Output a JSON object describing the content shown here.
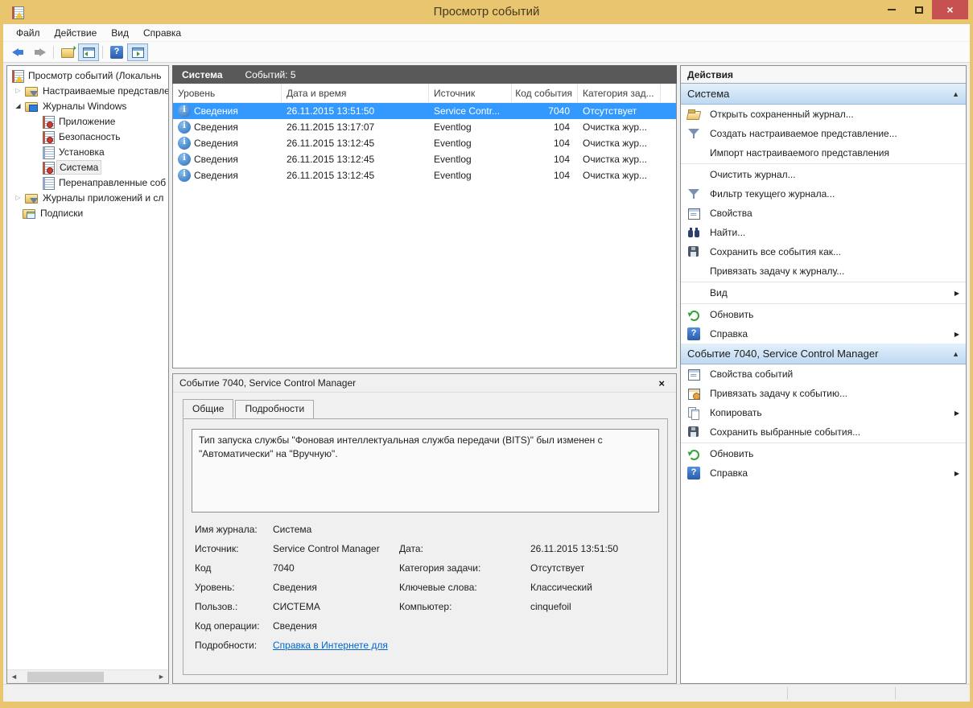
{
  "window": {
    "title": "Просмотр событий",
    "controls": {
      "minimize": "minimize",
      "maximize": "maximize",
      "close": "×"
    }
  },
  "menu": {
    "items": [
      {
        "label": "Файл"
      },
      {
        "label": "Действие"
      },
      {
        "label": "Вид"
      },
      {
        "label": "Справка"
      }
    ]
  },
  "toolbar": {
    "icons": [
      "back",
      "forward",
      "export-log",
      "toggle-console-tree",
      "help",
      "toggle-action-pane"
    ]
  },
  "tree": {
    "items": [
      {
        "label": "Просмотр событий (Локальнь",
        "icon": "event-viewer-root",
        "level": 0
      },
      {
        "label": "Настраиваемые представле",
        "icon": "folder-filter",
        "level": 1,
        "state": "collapsed"
      },
      {
        "label": "Журналы Windows",
        "icon": "folder-screen",
        "level": 1,
        "state": "expanded"
      },
      {
        "label": "Приложение",
        "icon": "log-alert",
        "level": 2
      },
      {
        "label": "Безопасность",
        "icon": "log-alert",
        "level": 2
      },
      {
        "label": "Установка",
        "icon": "log-plain",
        "level": 2
      },
      {
        "label": "Система",
        "icon": "log-alert",
        "level": 2,
        "selected": true
      },
      {
        "label": "Перенаправленные соб",
        "icon": "log-plain",
        "level": 2
      },
      {
        "label": "Журналы приложений и сл",
        "icon": "folder-filter",
        "level": 1,
        "state": "collapsed"
      },
      {
        "label": "Подписки",
        "icon": "subscriptions",
        "level": 1
      }
    ]
  },
  "list": {
    "caption": "Система",
    "count": "Событий: 5",
    "columns": [
      "Уровень",
      "Дата и время",
      "Источник",
      "Код события",
      "Категория зад..."
    ],
    "rows": [
      {
        "icon": "info",
        "level": "Сведения",
        "datetime": "26.11.2015 13:51:50",
        "source": "Service Contr...",
        "code": "7040",
        "category": "Отсутствует",
        "selected": true
      },
      {
        "icon": "info",
        "level": "Сведения",
        "datetime": "26.11.2015 13:17:07",
        "source": "Eventlog",
        "code": "104",
        "category": "Очистка жур..."
      },
      {
        "icon": "info",
        "level": "Сведения",
        "datetime": "26.11.2015 13:12:45",
        "source": "Eventlog",
        "code": "104",
        "category": "Очистка жур..."
      },
      {
        "icon": "info",
        "level": "Сведения",
        "datetime": "26.11.2015 13:12:45",
        "source": "Eventlog",
        "code": "104",
        "category": "Очистка жур..."
      },
      {
        "icon": "info",
        "level": "Сведения",
        "datetime": "26.11.2015 13:12:45",
        "source": "Eventlog",
        "code": "104",
        "category": "Очистка жур..."
      }
    ]
  },
  "preview": {
    "title": "Событие 7040, Service Control Manager",
    "close": "×",
    "tabs": [
      {
        "label": "Общие",
        "active": true
      },
      {
        "label": "Подробности",
        "active": false
      }
    ],
    "description": "Тип запуска службы \"Фоновая интеллектуальная служба передачи (BITS)\" был изменен с \"Автоматически\" на \"Вручную\".",
    "fields": {
      "log_label": "Имя журнала:",
      "log": "Система",
      "source_label": "Источник:",
      "source": "Service Control Manager",
      "code_label": "Код",
      "code": "7040",
      "level_label": "Уровень:",
      "level": "Сведения",
      "user_label": "Пользов.:",
      "user": "СИСТЕМА",
      "opcode_label": "Код операции:",
      "opcode": "Сведения",
      "details_label": "Подробности:",
      "details_link": "Справка в Интернете для ",
      "date_label": "Дата:",
      "date": "26.11.2015 13:51:50",
      "category_label": "Категория задачи:",
      "category": "Отсутствует",
      "keywords_label": "Ключевые слова:",
      "keywords": "Классический",
      "computer_label": "Компьютер:",
      "computer": "cinquefoil"
    }
  },
  "actions": {
    "header": "Действия",
    "sections": [
      {
        "title": "Система",
        "items": [
          {
            "label": "Открыть сохраненный журнал...",
            "icon": "open-folder"
          },
          {
            "label": "Создать настраиваемое представление...",
            "icon": "filter"
          },
          {
            "label": "Импорт настраиваемого представления",
            "icon": "none"
          },
          {
            "label": "Очистить журнал...",
            "icon": "none"
          },
          {
            "label": "Фильтр текущего журнала...",
            "icon": "filter"
          },
          {
            "label": "Свойства",
            "icon": "properties"
          },
          {
            "label": "Найти...",
            "icon": "binoculars"
          },
          {
            "label": "Сохранить все события как...",
            "icon": "save"
          },
          {
            "label": "Привязать задачу к журналу...",
            "icon": "none"
          },
          {
            "label": "Вид",
            "icon": "none",
            "submenu": true
          },
          {
            "label": "Обновить",
            "icon": "refresh"
          },
          {
            "label": "Справка",
            "icon": "help",
            "submenu": true
          }
        ]
      },
      {
        "title": "Событие 7040, Service Control Manager",
        "items": [
          {
            "label": "Свойства событий",
            "icon": "properties"
          },
          {
            "label": "Привязать задачу к событию...",
            "icon": "task"
          },
          {
            "label": "Копировать",
            "icon": "copy",
            "submenu": true
          },
          {
            "label": "Сохранить выбранные события...",
            "icon": "save"
          },
          {
            "label": "Обновить",
            "icon": "refresh"
          },
          {
            "label": "Справка",
            "icon": "help",
            "submenu": true
          }
        ]
      }
    ]
  },
  "colors": {
    "titlebar": "#e9c56f",
    "selection": "#3399ff",
    "caption_bar": "#595959",
    "section_header": "#bed9f2",
    "link": "#0066cc",
    "close_button": "#c75050"
  }
}
